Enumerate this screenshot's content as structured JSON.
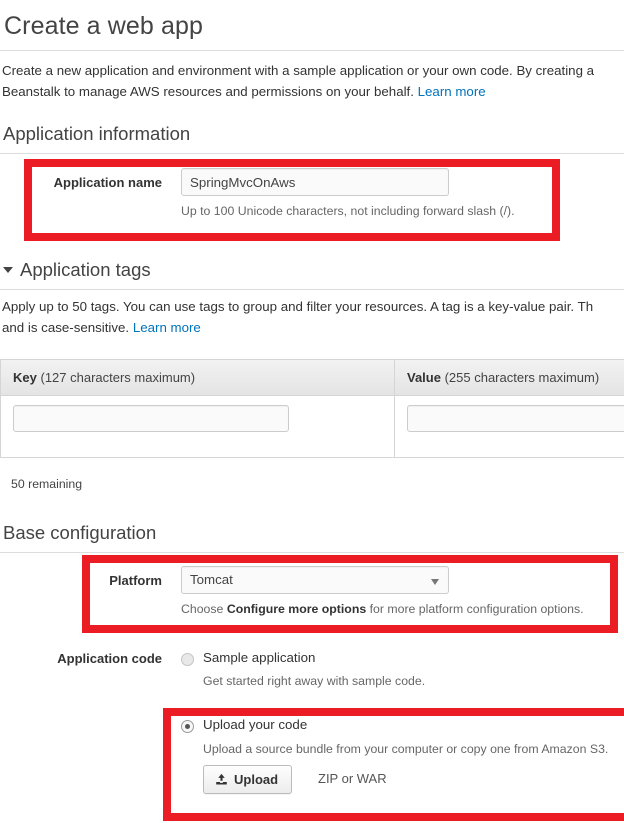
{
  "page": {
    "title": "Create a web app",
    "intro_line1": "Create a new application and environment with a sample application or your own code. By creating a",
    "intro_line2": "Beanstalk to manage AWS resources and permissions on your behalf.",
    "intro_link": "Learn more"
  },
  "application_information": {
    "heading": "Application information",
    "name_label": "Application name",
    "name_value": "SpringMvcOnAws",
    "name_hint": "Up to 100 Unicode characters, not including forward slash (/)."
  },
  "application_tags": {
    "heading": "Application tags",
    "desc_line1": "Apply up to 50 tags. You can use tags to group and filter your resources. A tag is a key-value pair. Th",
    "desc_line2": "and is case-sensitive.",
    "desc_link": "Learn more",
    "table": {
      "columns": [
        {
          "title": "Key",
          "note": "(127 characters maximum)"
        },
        {
          "title": "Value",
          "note": "(255 characters maximum)"
        }
      ],
      "rows": [
        {
          "key": "",
          "value": ""
        }
      ]
    },
    "remaining": "50 remaining"
  },
  "base_configuration": {
    "heading": "Base configuration",
    "platform_label": "Platform",
    "platform_value": "Tomcat",
    "platform_options": [
      "Tomcat"
    ],
    "platform_hint_pre": "Choose ",
    "platform_hint_bold": "Configure more options",
    "platform_hint_post": " for more platform configuration options."
  },
  "application_code": {
    "label": "Application code",
    "options": [
      {
        "label": "Sample application",
        "sub": "Get started right away with sample code.",
        "selected": false
      },
      {
        "label": "Upload your code",
        "sub": "Upload a source bundle from your computer or copy one from Amazon S3.",
        "selected": true
      }
    ],
    "upload_button": "Upload",
    "upload_icon": "upload-icon",
    "upload_formats": "ZIP or WAR"
  },
  "annotations": {
    "color": "#ec1c24",
    "boxes": [
      "application-name",
      "platform",
      "upload-your-code"
    ]
  }
}
